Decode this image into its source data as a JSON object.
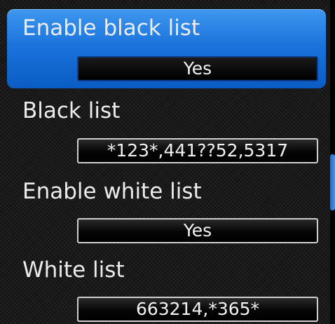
{
  "settings": [
    {
      "label": "Enable black list",
      "value": "Yes",
      "selected": true
    },
    {
      "label": "Black list",
      "value": "*123*,441??52,5317",
      "selected": false
    },
    {
      "label": "Enable white list",
      "value": "Yes",
      "selected": false
    },
    {
      "label": "White list",
      "value": "663214,*365*",
      "selected": false
    }
  ],
  "colors": {
    "selection": "#1b74dc",
    "scroll_thumb": "#3f97f0",
    "text": "#ececec",
    "background": "#141414"
  }
}
